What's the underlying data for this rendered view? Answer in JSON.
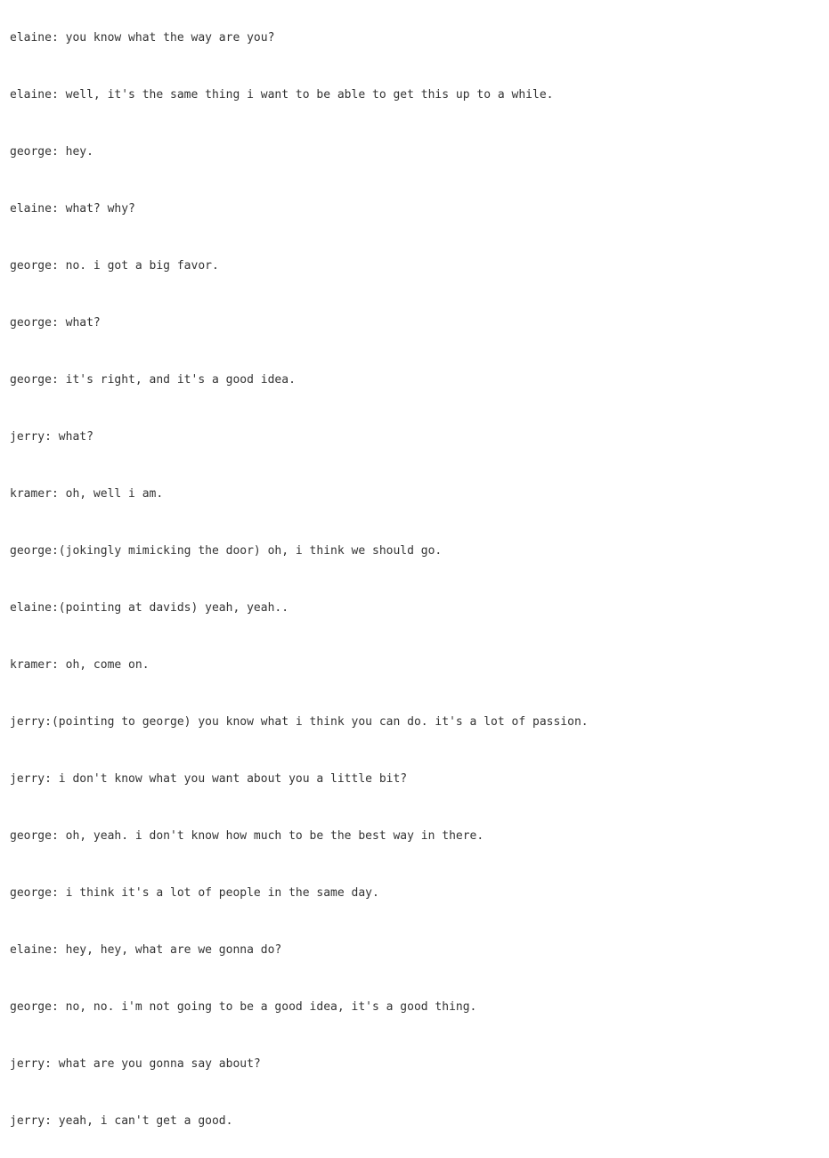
{
  "transcript": {
    "lines": [
      "elaine: you know what the way are you?",
      "elaine: well, it's the same thing i want to be able to get this up to a while.",
      "george: hey.",
      "elaine: what? why?",
      "george: no. i got a big favor.",
      "george: what?",
      "george: it's right, and it's a good idea.",
      "jerry: what?",
      "kramer: oh, well i am.",
      "george:(jokingly mimicking the door) oh, i think we should go.",
      "elaine:(pointing at davids) yeah, yeah..",
      "kramer: oh, come on.",
      "jerry:(pointing to george) you know what i think you can do. it's a lot of passion.",
      "jerry: i don't know what you want about you a little bit?",
      "george: oh, yeah. i don't know how much to be the best way in there.",
      "george: i think it's a lot of people in the same day.",
      "elaine: hey, hey, what are we gonna do?",
      "george: no, no. i'm not going to be a good idea, it's a good thing.",
      "jerry: what are you gonna say about?",
      "jerry: yeah, i can't get a good."
    ]
  }
}
